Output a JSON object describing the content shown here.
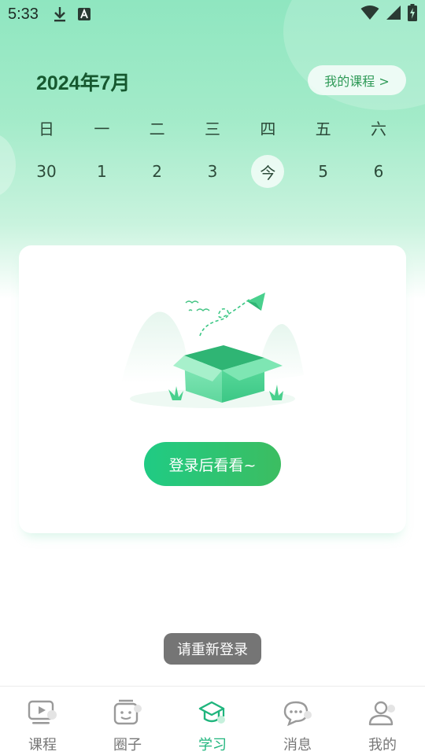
{
  "status_bar": {
    "time": "5:33",
    "icons": [
      "download-icon",
      "a-notification-icon",
      "wifi-icon",
      "cell-signal-icon",
      "battery-charging-icon"
    ]
  },
  "calendar": {
    "month_title": "2024年7月",
    "my_courses_label": "我的课程 >",
    "weekdays": [
      "日",
      "一",
      "二",
      "三",
      "四",
      "五",
      "六"
    ],
    "dates": [
      "30",
      "1",
      "2",
      "3",
      "今",
      "5",
      "6"
    ],
    "today_index": 4
  },
  "empty_card": {
    "illustration": "empty-box-illustration",
    "login_button_label": "登录后看看~"
  },
  "toast": {
    "message": "请重新登录"
  },
  "bottom_nav": {
    "items": [
      {
        "label": "课程",
        "icon": "video-course-icon"
      },
      {
        "label": "圈子",
        "icon": "circle-face-icon"
      },
      {
        "label": "学习",
        "icon": "graduation-cap-icon"
      },
      {
        "label": "消息",
        "icon": "chat-bubble-icon"
      },
      {
        "label": "我的",
        "icon": "user-icon"
      }
    ],
    "active_index": 2
  },
  "colors": {
    "accent": "#1fb57d",
    "title_green": "#16582f",
    "inactive_nav": "#777777"
  }
}
